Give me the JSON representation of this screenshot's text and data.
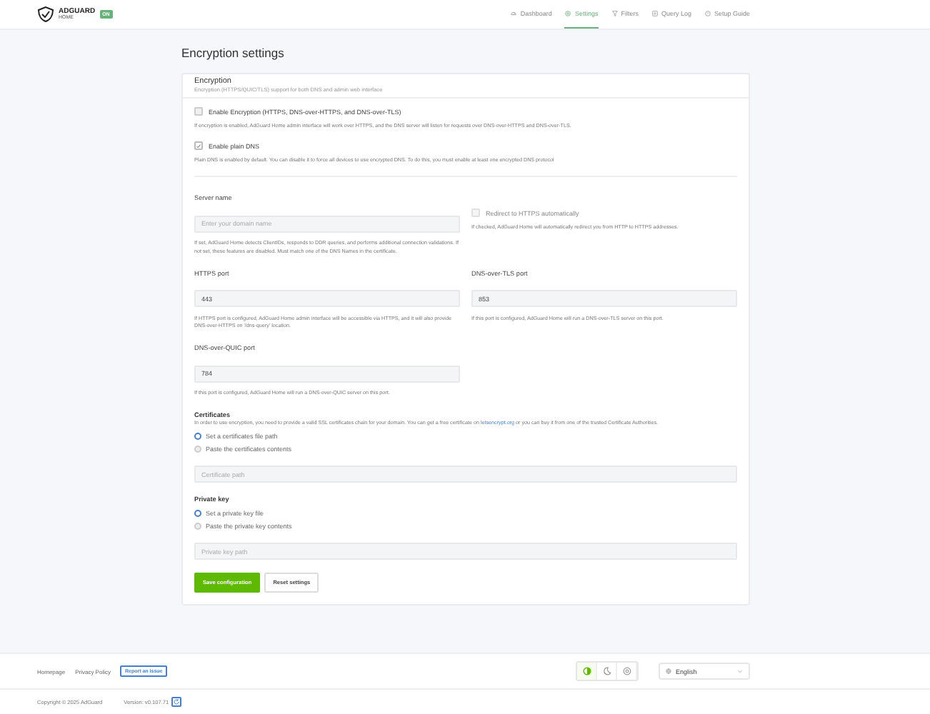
{
  "header": {
    "logo": {
      "name": "ADGUARD",
      "sub": "HOME",
      "badge": "ON"
    },
    "nav": [
      {
        "label": "Dashboard",
        "kind": "dashboard",
        "selected": false
      },
      {
        "label": "Settings",
        "kind": "settings",
        "selected": true
      },
      {
        "label": "Filters",
        "kind": "filters",
        "selected": false
      },
      {
        "label": "Query Log",
        "kind": "log",
        "selected": false
      },
      {
        "label": "Setup Guide",
        "kind": "guide",
        "selected": false
      }
    ]
  },
  "page_title": "Encryption settings",
  "card": {
    "title": "Encryption",
    "subtitle": "Encryption (HTTPS/QUIC/TLS) support for both DNS and admin web interface",
    "options": [
      {
        "label": "Enable Encryption (HTTPS, DNS-over-HTTPS, and DNS-over-TLS)",
        "checked": false,
        "hint": "If encryption is enabled, AdGuard Home admin interface will work over HTTPS, and the DNS server will listen for requests over DNS-over-HTTPS and DNS-over-TLS."
      },
      {
        "label": "Enable plain DNS",
        "checked": true,
        "hint": "Plain DNS is enabled by default. You can disable it to force all devices to use encrypted DNS. To do this, you must enable at least one encrypted DNS protocol"
      }
    ],
    "server_name": {
      "label": "Server name",
      "placeholder": "Enter your domain name",
      "hint": "If set, AdGuard Home detects ClientIDs, responds to DDR queries, and performs additional connection validations. If not set, these features are disabled. Must match one of the DNS Names in the certificate."
    },
    "redirect": {
      "label": "Redirect to HTTPS automatically",
      "checked": false,
      "disabled": true,
      "hint": "If checked, AdGuard Home will automatically redirect you from HTTP to HTTPS addresses."
    },
    "ports": [
      {
        "label": "HTTPS port",
        "value": "443",
        "hint": "If HTTPS port is configured, AdGuard Home admin interface will be accessible via HTTPS, and it will also provide DNS-over-HTTPS on '/dns-query' location."
      },
      {
        "label": "DNS-over-TLS port",
        "value": "853",
        "hint": "If this port is configured, AdGuard Home will run a DNS-over-TLS server on this port."
      },
      {
        "label": "DNS-over-QUIC port",
        "value": "784",
        "hint": "If this port is configured, AdGuard Home will run a DNS-over-QUIC server on this port."
      }
    ],
    "certificates": {
      "title": "Certificates",
      "text_before": "In order to use encryption, you need to provide a valid SSL certificates chain for your domain. You can get a free certificate on",
      "link": "letsencrypt.org",
      "text_after": "or you can buy it from one of the trusted Certificate Authorities.",
      "radios": [
        {
          "label": "Set a certificates file path",
          "selected": true
        },
        {
          "label": "Paste the certificates contents",
          "selected": false
        }
      ],
      "placeholder": "Certificate path"
    },
    "private_key": {
      "title": "Private key",
      "radios": [
        {
          "label": "Set a private key file",
          "selected": true
        },
        {
          "label": "Paste the private key contents",
          "selected": false
        }
      ],
      "placeholder": "Private key path"
    },
    "buttons": [
      {
        "label": "Save configuration",
        "kind": "primary"
      },
      {
        "label": "Reset settings",
        "kind": "secondary"
      }
    ]
  },
  "footer": {
    "links": [
      "Homepage",
      "Privacy Policy"
    ],
    "report": "Report an issue",
    "themes": [
      {
        "kind": "auto",
        "selected": true
      },
      {
        "kind": "dark",
        "selected": false
      },
      {
        "kind": "light",
        "selected": false
      }
    ],
    "language": "English",
    "copyright": "Copyright © 2025 AdGuard",
    "version": "Version: v0.107.71"
  }
}
